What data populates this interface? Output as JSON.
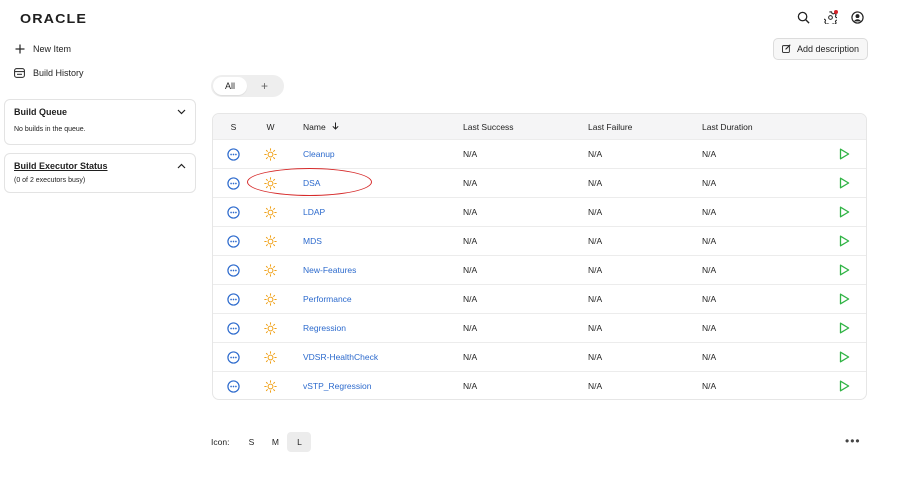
{
  "header": {
    "logo": "ORACLE",
    "icons": [
      "search-icon",
      "gear-icon",
      "user-icon"
    ],
    "notification_color": "#d6232a"
  },
  "sidebar": {
    "links": [
      {
        "label": "New Item",
        "icon": "plus-icon"
      },
      {
        "label": "Build History",
        "icon": "history-icon"
      }
    ],
    "build_queue": {
      "title": "Build Queue",
      "body": "No builds in the queue."
    },
    "executor_status": {
      "title": "Build Executor Status",
      "body": "(0 of 2 executors busy)"
    }
  },
  "actions": {
    "add_description": "Add description"
  },
  "tabs": {
    "all": "All",
    "add": "+"
  },
  "table": {
    "headers": {
      "s": "S",
      "w": "W",
      "name": "Name",
      "last_success": "Last Success",
      "last_failure": "Last Failure",
      "last_duration": "Last Duration"
    },
    "rows": [
      {
        "name": "Cleanup",
        "last_success": "N/A",
        "last_failure": "N/A",
        "last_duration": "N/A"
      },
      {
        "name": "DSA",
        "last_success": "N/A",
        "last_failure": "N/A",
        "last_duration": "N/A"
      },
      {
        "name": "LDAP",
        "last_success": "N/A",
        "last_failure": "N/A",
        "last_duration": "N/A"
      },
      {
        "name": "MDS",
        "last_success": "N/A",
        "last_failure": "N/A",
        "last_duration": "N/A"
      },
      {
        "name": "New-Features",
        "last_success": "N/A",
        "last_failure": "N/A",
        "last_duration": "N/A"
      },
      {
        "name": "Performance",
        "last_success": "N/A",
        "last_failure": "N/A",
        "last_duration": "N/A"
      },
      {
        "name": "Regression",
        "last_success": "N/A",
        "last_failure": "N/A",
        "last_duration": "N/A"
      },
      {
        "name": "VDSR-HealthCheck",
        "last_success": "N/A",
        "last_failure": "N/A",
        "last_duration": "N/A"
      },
      {
        "name": "vSTP_Regression",
        "last_success": "N/A",
        "last_failure": "N/A",
        "last_duration": "N/A"
      }
    ]
  },
  "icon_size": {
    "label": "Icon:",
    "options": [
      "S",
      "M",
      "L"
    ],
    "selected": "L"
  },
  "colors": {
    "link": "#2c6acd",
    "status": "#2c6acd",
    "weather": "#f0a21b",
    "run": "#2fb344",
    "annotation": "#d62a2a"
  }
}
